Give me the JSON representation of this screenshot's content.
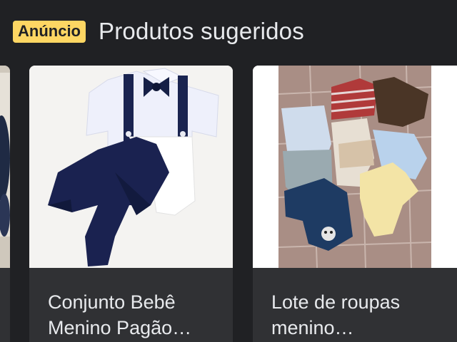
{
  "header": {
    "badge": "Anúncio",
    "title": "Produtos sugeridos"
  },
  "products": [
    {
      "title_line1": "Conjunto Bebê",
      "title_line2": "Menino Pagão…",
      "image": "navy-bodysuit-with-bowtie-and-suspenders"
    },
    {
      "title_line1": "Lote de roupas",
      "title_line2": "menino…",
      "image": "assorted-baby-clothes-on-tile-floor"
    }
  ],
  "colors": {
    "background": "#202124",
    "card": "#303134",
    "badge": "#fdd663",
    "text": "#e8eaed"
  }
}
